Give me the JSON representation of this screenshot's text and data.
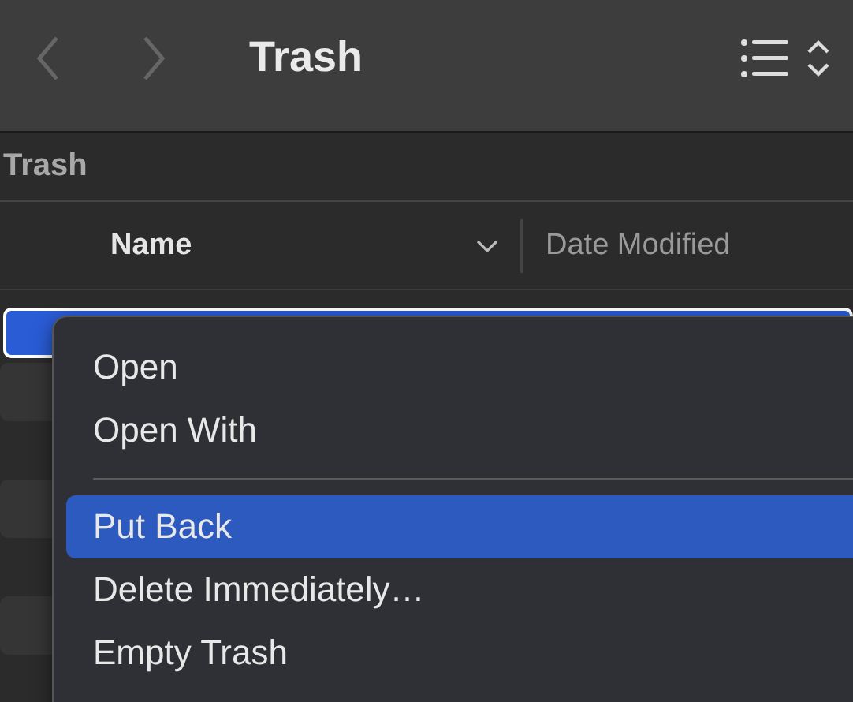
{
  "window": {
    "title": "Trash"
  },
  "section": {
    "title": "Trash"
  },
  "columns": [
    {
      "label": "Name",
      "sorted": true
    },
    {
      "label": "Date Modified",
      "sorted": false
    }
  ],
  "rows": [
    {
      "selected": true
    },
    {
      "selected": false
    },
    {
      "selected": false
    },
    {
      "selected": false
    },
    {
      "selected": false
    },
    {
      "selected": false
    }
  ],
  "context_menu": [
    {
      "kind": "item",
      "label": "Open",
      "selected": false
    },
    {
      "kind": "item",
      "label": "Open With",
      "selected": false
    },
    {
      "kind": "separator"
    },
    {
      "kind": "item",
      "label": "Put Back",
      "selected": true
    },
    {
      "kind": "item",
      "label": "Delete Immediately…",
      "selected": false
    },
    {
      "kind": "item",
      "label": "Empty Trash",
      "selected": false
    }
  ]
}
